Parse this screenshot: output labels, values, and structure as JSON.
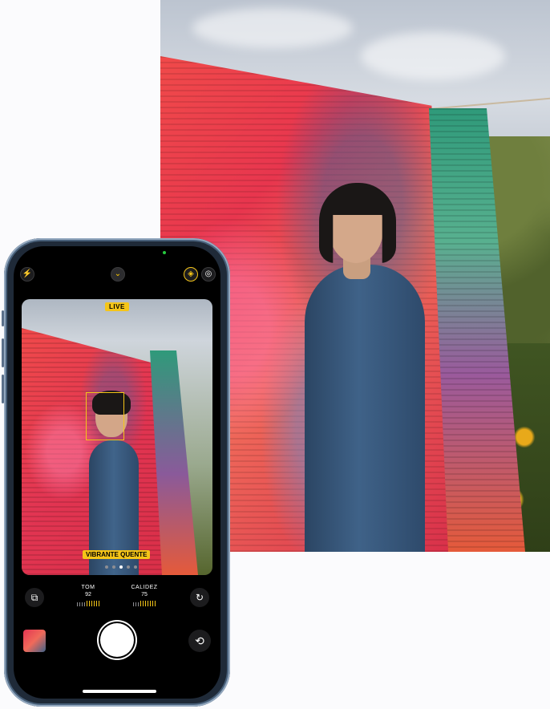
{
  "camera": {
    "live_label": "LIVE",
    "style_label": "VIBRANTE QUENTE",
    "style_dots_total": 5,
    "style_dot_active_index": 2,
    "tone": {
      "label": "TOM",
      "value": "92"
    },
    "warmth": {
      "label": "CALIDEZ",
      "value": "75"
    },
    "icons": {
      "flash": "flash-icon",
      "chevron": "chevron-down-icon",
      "styles": "photographic-styles-icon",
      "live": "live-photo-icon",
      "styles_reset": "styles-icon",
      "reset": "reset-icon",
      "flip": "camera-flip-icon"
    },
    "colors": {
      "accent": "#f5c518",
      "phone_frame": "#1f2a38"
    }
  }
}
